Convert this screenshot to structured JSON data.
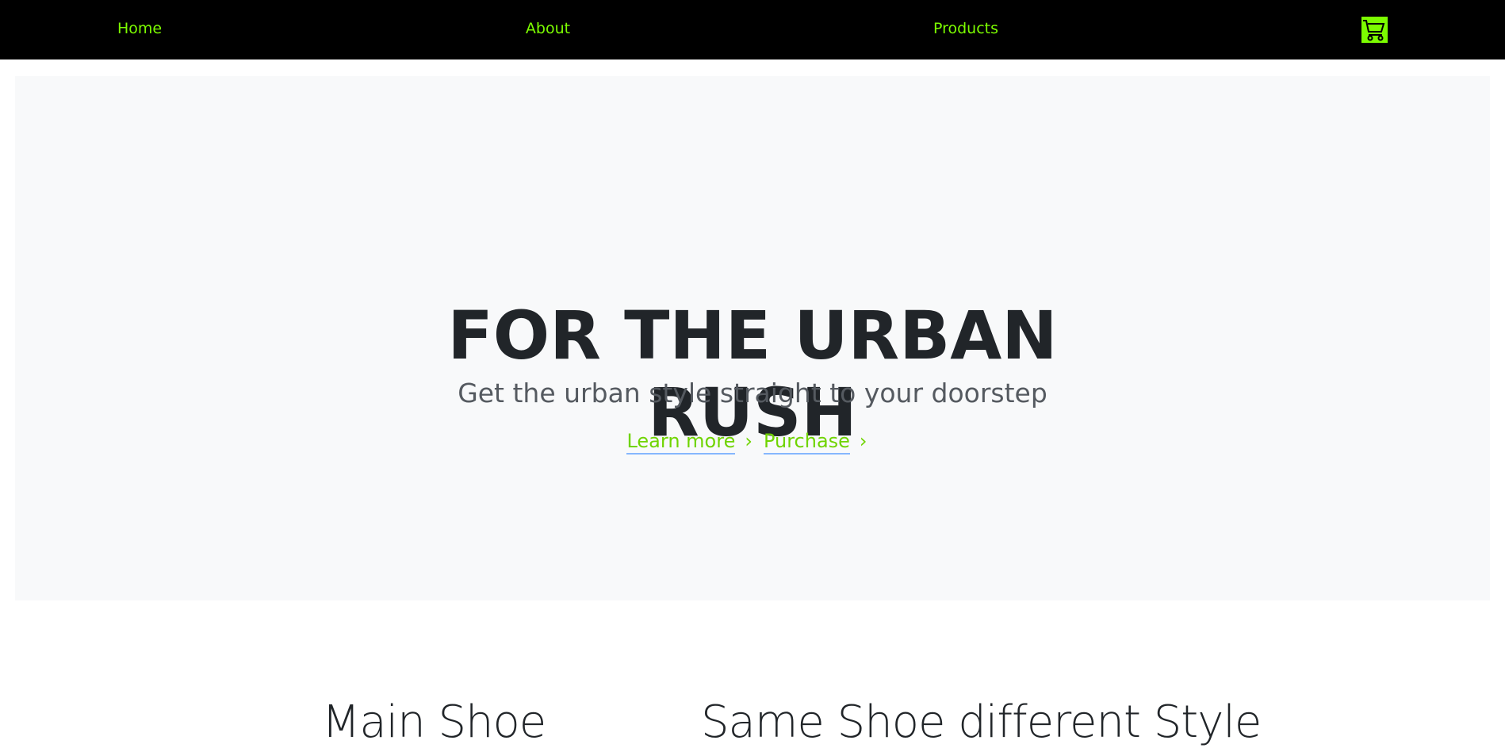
{
  "nav": {
    "items": [
      {
        "label": "Home"
      },
      {
        "label": "About"
      },
      {
        "label": "Products"
      }
    ],
    "cart_icon": "shopping-cart-icon",
    "accent_color": "#7cfc00"
  },
  "hero": {
    "title_line1": "FOR THE URBAN",
    "title_line2": "RUSH",
    "subtitle": "Get the urban style straight to your doorstep",
    "links": [
      {
        "label": "Learn more",
        "icon": "chevron-right-icon"
      },
      {
        "label": "Purchase",
        "icon": "chevron-right-icon"
      }
    ]
  },
  "sections": [
    {
      "heading": "Main Shoe"
    },
    {
      "heading": "Same Shoe different Style"
    }
  ]
}
